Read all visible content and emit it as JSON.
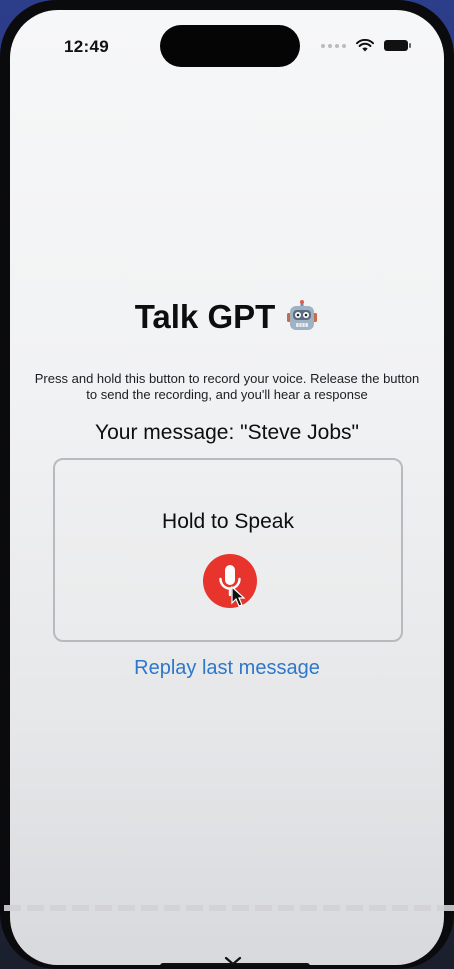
{
  "status_bar": {
    "time": "12:49"
  },
  "app": {
    "title": "Talk GPT",
    "title_emoji": "🤖",
    "instructions": "Press and hold this button to record your voice. Release the button to send the recording, and you'll hear a response",
    "your_message": "Your message: \"Steve Jobs\"",
    "hold_button_label": "Hold to Speak",
    "replay_link": "Replay last message"
  },
  "icons": {
    "mic": "microphone-icon",
    "signal": "signal-dots-icon",
    "wifi": "wifi-icon",
    "battery": "battery-icon"
  },
  "colors": {
    "mic_button": "#e7342d",
    "link": "#2f77c9"
  }
}
